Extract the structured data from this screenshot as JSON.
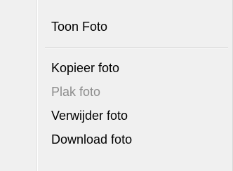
{
  "context_menu": {
    "items": [
      {
        "label": "Toon Foto",
        "enabled": true
      },
      {
        "label": "Kopieer foto",
        "enabled": true
      },
      {
        "label": "Plak foto",
        "enabled": false
      },
      {
        "label": "Verwijder foto",
        "enabled": true
      },
      {
        "label": "Download foto",
        "enabled": true
      }
    ]
  }
}
